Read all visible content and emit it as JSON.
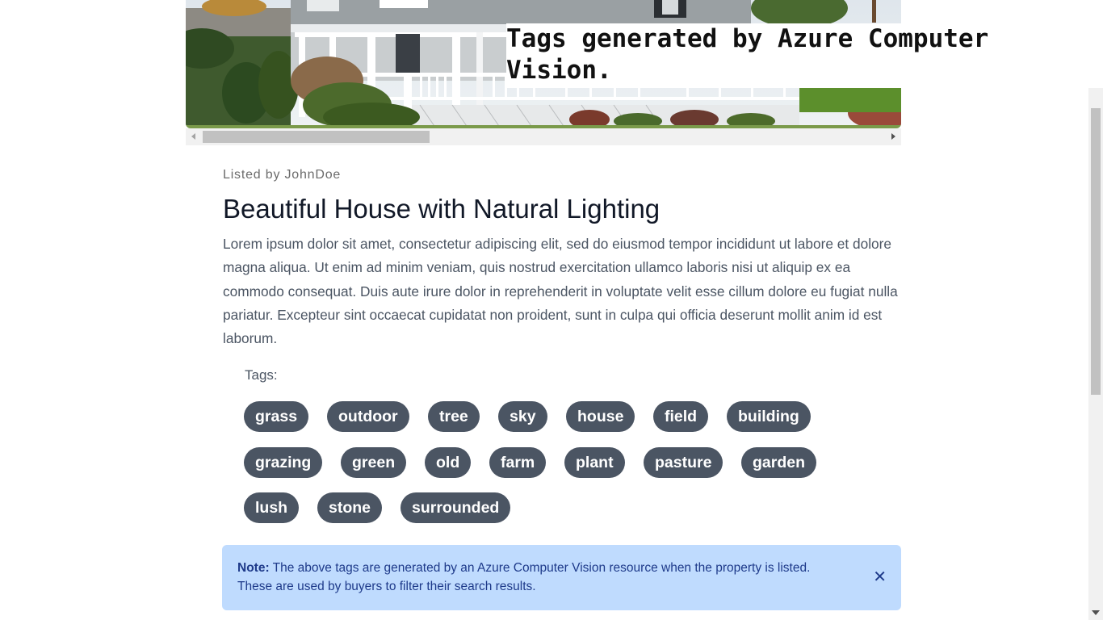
{
  "hero": {
    "caption": "Tags generated by Azure Computer Vision."
  },
  "listing": {
    "listed_by": "Listed by JohnDoe",
    "title": "Beautiful House with Natural Lighting",
    "description": "Lorem ipsum dolor sit amet, consectetur adipiscing elit, sed do eiusmod tempor incididunt ut labore et dolore magna aliqua. Ut enim ad minim veniam, quis nostrud exercitation ullamco laboris nisi ut aliquip ex ea commodo consequat. Duis aute irure dolor in reprehenderit in voluptate velit esse cillum dolore eu fugiat nulla pariatur. Excepteur sint occaecat cupidatat non proident, sunt in culpa qui officia deserunt mollit anim id est laborum."
  },
  "tags": {
    "label": "Tags:",
    "items": [
      "grass",
      "outdoor",
      "tree",
      "sky",
      "house",
      "field",
      "building",
      "grazing",
      "green",
      "old",
      "farm",
      "plant",
      "pasture",
      "garden",
      "lush",
      "stone",
      "surrounded"
    ]
  },
  "note": {
    "bold": "Note:",
    "text": " The above tags are generated by an Azure Computer Vision resource when the property is listed. These are used by buyers to filter their search results.",
    "close_icon": "close-icon"
  },
  "colors": {
    "tag_bg": "#4b5563",
    "note_bg": "#bfdbfe",
    "note_text": "#1e3a8a"
  }
}
